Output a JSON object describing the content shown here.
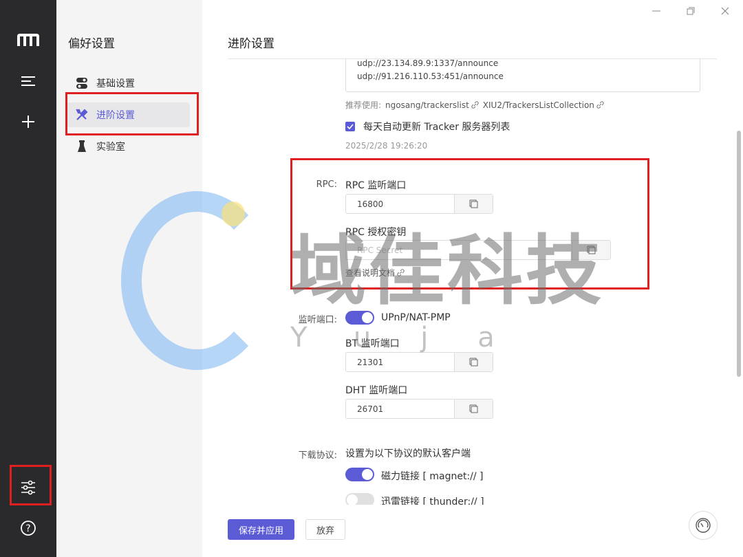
{
  "sidebar": {
    "logo_icon": "motrix-logo-icon",
    "menu_icon": "menu-icon",
    "add_icon": "plus-icon",
    "prefs_icon": "sliders-icon",
    "help_icon": "help-icon"
  },
  "prefs": {
    "title": "偏好设置",
    "items": [
      {
        "label": "基础设置",
        "icon": "toggle-icon"
      },
      {
        "label": "进阶设置",
        "icon": "tools-icon"
      },
      {
        "label": "实验室",
        "icon": "flask-icon"
      }
    ]
  },
  "main": {
    "title": "进阶设置",
    "tracker_lines": [
      "udp://23.134.89.9:1337/announce",
      "udp://91.216.110.53:451/announce"
    ],
    "recommend_label": "推荐使用:",
    "recommend_links": [
      "ngosang/trackerslist",
      "XIU2/TrackersListCollection"
    ],
    "auto_update_label": "每天自动更新 Tracker 服务器列表",
    "last_update": "2025/2/28 19:26:20",
    "rpc": {
      "row_label": "RPC:",
      "port_label": "RPC 监听端口",
      "port_value": "16800",
      "secret_label": "RPC 授权密钥",
      "secret_placeholder": "RPC Secret",
      "doc_link": "查看说明文档"
    },
    "listen": {
      "row_label": "监听端口:",
      "upnp_label": "UPnP/NAT-PMP",
      "upnp_on": true,
      "bt_label": "BT 监听端口",
      "bt_value": "21301",
      "dht_label": "DHT 监听端口",
      "dht_value": "26701"
    },
    "protocol": {
      "row_label": "下载协议:",
      "description": "设置为以下协议的默认客户端",
      "magnet_label": "磁力链接 [ magnet:// ]",
      "magnet_on": true,
      "thunder_label": "迅雷链接 [ thunder:// ]",
      "thunder_on": false
    },
    "save_label": "保存并应用",
    "discard_label": "放弃"
  },
  "watermark": {
    "text": "域佳科技",
    "sub": "Yuja"
  },
  "colors": {
    "accent": "#5b5bd6",
    "sidebar_bg": "#2a2a2c",
    "highlight": "#e02020"
  }
}
